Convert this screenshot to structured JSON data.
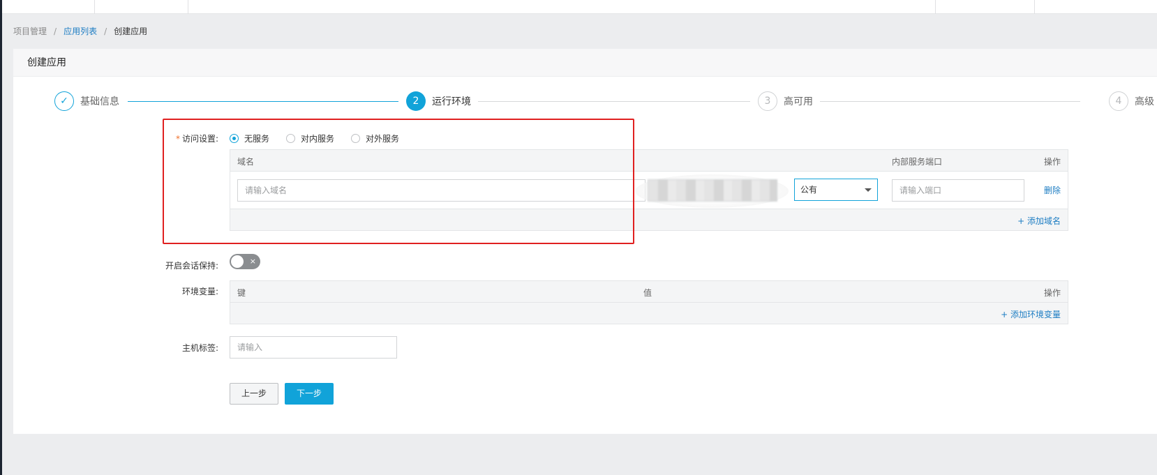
{
  "breadcrumb": {
    "item1": "项目管理",
    "item2": "应用列表",
    "item3": "创建应用",
    "separator": "/"
  },
  "panel": {
    "title": "创建应用"
  },
  "steps": [
    {
      "number": "✓",
      "label": "基础信息",
      "state": "done"
    },
    {
      "number": "2",
      "label": "运行环境",
      "state": "active"
    },
    {
      "number": "3",
      "label": "高可用",
      "state": "todo"
    },
    {
      "number": "4",
      "label": "高级",
      "state": "todo"
    }
  ],
  "access": {
    "label": "访问设置:",
    "required_mark": "*",
    "options": [
      {
        "label": "无服务",
        "checked": true
      },
      {
        "label": "对内服务",
        "checked": false
      },
      {
        "label": "对外服务",
        "checked": false
      }
    ],
    "table": {
      "col_domain": "域名",
      "col_port": "内部服务端口",
      "col_action": "操作",
      "domain_placeholder": "请输入域名",
      "visibility_value": "公有",
      "port_placeholder": "请输入端口",
      "delete_label": "删除",
      "add_label": "+ 添加域名"
    }
  },
  "session": {
    "label": "开启会话保持:",
    "enabled": false,
    "toggle_glyph": "×"
  },
  "env": {
    "label": "环境变量:",
    "col_key": "键",
    "col_value": "值",
    "col_action": "操作",
    "add_label": "+ 添加环境变量"
  },
  "host_tag": {
    "label": "主机标签:",
    "placeholder": "请输入"
  },
  "buttons": {
    "prev": "上一步",
    "next": "下一步"
  },
  "colors": {
    "accent": "#11a3d9",
    "link": "#1d7dc3",
    "highlight_box": "#e02020"
  }
}
